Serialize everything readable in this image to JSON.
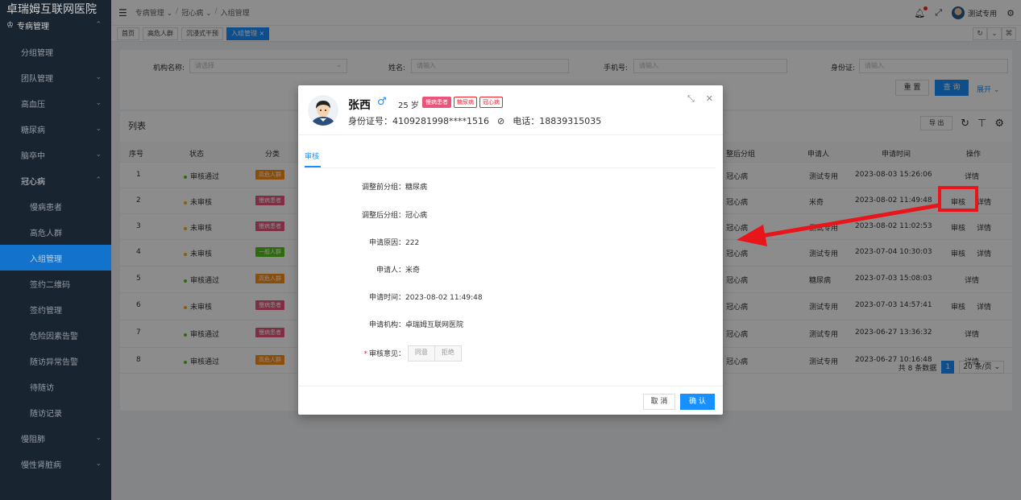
{
  "app": {
    "title": "卓瑞姆互联网医院"
  },
  "sidebar": {
    "top": {
      "label": "专病管理"
    },
    "items": [
      {
        "label": "分组管理",
        "chev": ""
      },
      {
        "label": "团队管理",
        "chev": "⌄"
      },
      {
        "label": "高血压",
        "chev": "⌄"
      },
      {
        "label": "糖尿病",
        "chev": "⌄"
      },
      {
        "label": "脑卒中",
        "chev": "⌄"
      },
      {
        "label": "冠心病",
        "chev": "⌃"
      },
      {
        "label": "慢病患者",
        "chev": ""
      },
      {
        "label": "高危人群",
        "chev": ""
      },
      {
        "label": "入组管理",
        "chev": ""
      },
      {
        "label": "签约二维码",
        "chev": ""
      },
      {
        "label": "签约管理",
        "chev": ""
      },
      {
        "label": "危险因素告警",
        "chev": ""
      },
      {
        "label": "随访异常告警",
        "chev": ""
      },
      {
        "label": "待随访",
        "chev": ""
      },
      {
        "label": "随访记录",
        "chev": ""
      },
      {
        "label": "慢阻肺",
        "chev": "⌄"
      },
      {
        "label": "慢性肾脏病",
        "chev": "⌄"
      }
    ]
  },
  "header": {
    "crumbs": [
      "专病管理 ⌄",
      "/",
      "冠心病 ⌄",
      "/",
      "入组管理"
    ],
    "user": "测试专用"
  },
  "tabs": [
    {
      "label": "首页"
    },
    {
      "label": "高危人群"
    },
    {
      "label": "沉浸式干预"
    },
    {
      "label": "入组管理 ×"
    }
  ],
  "filter": {
    "org_label": "机构名称:",
    "org_ph": "请选择",
    "name_label": "姓名:",
    "name_ph": "请输入",
    "phone_label": "手机号:",
    "phone_ph": "请输入",
    "id_label": "身份证:",
    "id_ph": "请输入",
    "reset": "重 置",
    "query": "查 询",
    "expand": "展开 ⌄"
  },
  "list": {
    "title": "列表",
    "export": "导 出",
    "headers": {
      "no": "序号",
      "status": "状态",
      "cat": "分类",
      "after": "整后分组",
      "applicant": "申请人",
      "time": "申请时间",
      "op": "操作"
    },
    "rows": [
      {
        "no": "1",
        "status": "审核通过",
        "scolor": "#52c41a",
        "tag": "高危人群",
        "tcolor": "#fa8c16",
        "after": "冠心病",
        "applicant": "测试专用",
        "time": "2023-08-03 15:26:06",
        "audit": "",
        "detail": "详情"
      },
      {
        "no": "2",
        "status": "未审核",
        "scolor": "#faad14",
        "tag": "慢病患者",
        "tcolor": "#e8547a",
        "after": "冠心病",
        "applicant": "米奇",
        "time": "2023-08-02 11:49:48",
        "audit": "审核",
        "detail": "详情"
      },
      {
        "no": "3",
        "status": "未审核",
        "scolor": "#faad14",
        "tag": "慢病患者",
        "tcolor": "#e8547a",
        "after": "冠心病",
        "applicant": "测试专用",
        "time": "2023-08-02 11:02:53",
        "audit": "审核",
        "detail": "详情"
      },
      {
        "no": "4",
        "status": "未审核",
        "scolor": "#faad14",
        "tag": "一般人群",
        "tcolor": "#52c41a",
        "after": "冠心病",
        "applicant": "测试专用",
        "time": "2023-07-04 10:30:03",
        "audit": "审核",
        "detail": "详情"
      },
      {
        "no": "5",
        "status": "审核通过",
        "scolor": "#52c41a",
        "tag": "高危人群",
        "tcolor": "#fa8c16",
        "after": "冠心病",
        "applicant": "糖尿病",
        "time": "2023-07-03 15:08:03",
        "audit": "",
        "detail": "详情"
      },
      {
        "no": "6",
        "status": "未审核",
        "scolor": "#faad14",
        "tag": "慢病患者",
        "tcolor": "#e8547a",
        "after": "冠心病",
        "applicant": "测试专用",
        "time": "2023-07-03 14:57:41",
        "audit": "审核",
        "detail": "详情"
      },
      {
        "no": "7",
        "status": "审核通过",
        "scolor": "#52c41a",
        "tag": "慢病患者",
        "tcolor": "#e8547a",
        "after": "冠心病",
        "applicant": "测试专用",
        "time": "2023-06-27 13:36:32",
        "audit": "",
        "detail": "详情"
      },
      {
        "no": "8",
        "status": "审核通过",
        "scolor": "#52c41a",
        "tag": "高危人群",
        "tcolor": "#fa8c16",
        "after": "冠心病",
        "applicant": "测试专用",
        "time": "2023-06-27 10:16:48",
        "audit": "",
        "detail": "详情"
      }
    ],
    "total": "共 8 条数据",
    "page": "1",
    "pagesize": "20 条/页 ⌄"
  },
  "modal": {
    "name": "张西",
    "gender": "♂",
    "age": "25 岁",
    "tags": [
      "慢病患者",
      "糖尿病",
      "冠心病"
    ],
    "id_text": "身份证号：4109281998****1516",
    "phone_text": "电话：18839315035",
    "tab": "审核",
    "fields": [
      {
        "label": "调整前分组：",
        "value": "糖尿病"
      },
      {
        "label": "调整后分组：",
        "value": "冠心病"
      },
      {
        "label": "申请原因：",
        "value": "222"
      },
      {
        "label": "申请人：",
        "value": "米奇"
      },
      {
        "label": "申请时间：",
        "value": "2023-08-02 11:49:48"
      },
      {
        "label": "申请机构：",
        "value": "卓瑞姆互联网医院"
      }
    ],
    "opinion_label": "审核意见：",
    "agree": "同意",
    "reject": "拒绝",
    "cancel": "取 消",
    "confirm": "确 认"
  },
  "colors": {
    "accent": "#1890ff",
    "annotation": "#e8151b",
    "sidebar": "#1f2d3d"
  }
}
